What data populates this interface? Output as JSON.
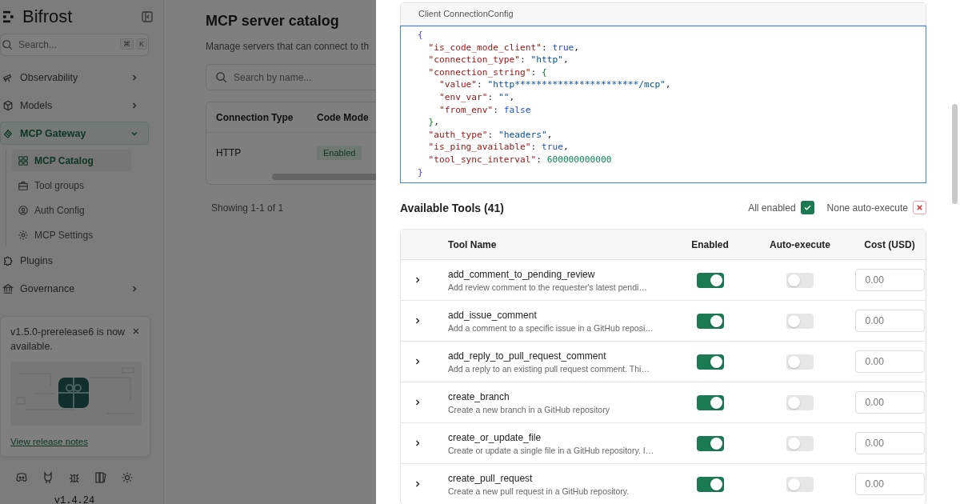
{
  "sidebar": {
    "brand": "Bifrost",
    "search": {
      "placeholder": "Search...",
      "shortcut": [
        "⌘",
        "K"
      ]
    },
    "items": [
      {
        "label": "Observability",
        "kind": "group",
        "expanded": false,
        "selected": false
      },
      {
        "label": "Models",
        "kind": "group",
        "expanded": false,
        "selected": false
      },
      {
        "label": "MCP Gateway",
        "kind": "group",
        "expanded": true,
        "selected": true,
        "children": [
          {
            "label": "MCP Catalog",
            "selected": true
          },
          {
            "label": "Tool groups",
            "selected": false
          },
          {
            "label": "Auth Config",
            "selected": false
          },
          {
            "label": "MCP Settings",
            "selected": false
          }
        ]
      },
      {
        "label": "Plugins",
        "kind": "link",
        "selected": false
      },
      {
        "label": "Governance",
        "kind": "group",
        "expanded": false,
        "selected": false
      }
    ],
    "notice": {
      "text": "v1.5.0-prerelease6 is now available.",
      "link": "View release notes"
    },
    "version": "v1.4.24"
  },
  "main": {
    "title": "MCP server catalog",
    "subtitle": "Manage servers that can connect to th",
    "search": {
      "placeholder": "Search by name..."
    },
    "table": {
      "columns": [
        "Connection Type",
        "Code Mode"
      ],
      "rows": [
        {
          "connection_type": "HTTP",
          "code_mode": "Enabled"
        }
      ]
    },
    "pagination": "Showing 1-1 of 1"
  },
  "sheet": {
    "config": {
      "title": "Client ConnectionConfig",
      "lines": [
        [
          {
            "kind": "brace",
            "text": "{"
          }
        ],
        [
          {
            "kind": "key",
            "text": "  \"is_code_mode_client\""
          },
          {
            "kind": "punct",
            "text": ": "
          },
          {
            "kind": "bool",
            "text": "true"
          },
          {
            "kind": "punct",
            "text": ","
          }
        ],
        [
          {
            "kind": "key",
            "text": "  \"connection_type\""
          },
          {
            "kind": "punct",
            "text": ": "
          },
          {
            "kind": "string",
            "text": "\"http\""
          },
          {
            "kind": "punct",
            "text": ","
          }
        ],
        [
          {
            "kind": "key",
            "text": "  \"connection_string\""
          },
          {
            "kind": "punct",
            "text": ": "
          },
          {
            "kind": "brace2",
            "text": "{"
          }
        ],
        [
          {
            "kind": "key",
            "text": "    \"value\""
          },
          {
            "kind": "punct",
            "text": ": "
          },
          {
            "kind": "string",
            "text": "\"http***********************/mcp\""
          },
          {
            "kind": "punct",
            "text": ","
          }
        ],
        [
          {
            "kind": "key",
            "text": "    \"env_var\""
          },
          {
            "kind": "punct",
            "text": ": "
          },
          {
            "kind": "string",
            "text": "\"\""
          },
          {
            "kind": "punct",
            "text": ","
          }
        ],
        [
          {
            "kind": "key",
            "text": "    \"from_env\""
          },
          {
            "kind": "punct",
            "text": ": "
          },
          {
            "kind": "bool",
            "text": "false"
          }
        ],
        [
          {
            "kind": "brace2",
            "text": "  }"
          },
          {
            "kind": "punct",
            "text": ","
          }
        ],
        [
          {
            "kind": "key",
            "text": "  \"auth_type\""
          },
          {
            "kind": "punct",
            "text": ": "
          },
          {
            "kind": "string",
            "text": "\"headers\""
          },
          {
            "kind": "punct",
            "text": ","
          }
        ],
        [
          {
            "kind": "key",
            "text": "  \"is_ping_available\""
          },
          {
            "kind": "punct",
            "text": ": "
          },
          {
            "kind": "bool",
            "text": "true"
          },
          {
            "kind": "punct",
            "text": ","
          }
        ],
        [
          {
            "kind": "key",
            "text": "  \"tool_sync_interval\""
          },
          {
            "kind": "punct",
            "text": ": "
          },
          {
            "kind": "number",
            "text": "600000000000"
          }
        ],
        [
          {
            "kind": "brace",
            "text": "}"
          }
        ]
      ]
    },
    "tools": {
      "title": "Available Tools (41)",
      "all_enabled": {
        "label": "All enabled",
        "kind": "all",
        "checked": true
      },
      "auto_execute": {
        "label": "None auto-execute",
        "kind": "none",
        "checked": true
      },
      "columns": [
        "Tool Name",
        "Enabled",
        "Auto-execute",
        "Cost (USD)"
      ],
      "rows": [
        {
          "name": "add_comment_to_pending_review",
          "description": "Add review comment to the requester's latest pendi…",
          "enabled": true,
          "auto_execute": false,
          "cost_placeholder": "0.00"
        },
        {
          "name": "add_issue_comment",
          "description": "Add a comment to a specific issue in a GitHub reposi…",
          "enabled": true,
          "auto_execute": false,
          "cost_placeholder": "0.00"
        },
        {
          "name": "add_reply_to_pull_request_comment",
          "description": "Add a reply to an existing pull request comment. Thi…",
          "enabled": true,
          "auto_execute": false,
          "cost_placeholder": "0.00"
        },
        {
          "name": "create_branch",
          "description": "Create a new branch in a GitHub repository",
          "enabled": true,
          "auto_execute": false,
          "cost_placeholder": "0.00"
        },
        {
          "name": "create_or_update_file",
          "description": "Create or update a single file in a GitHub repository. I…",
          "enabled": true,
          "auto_execute": false,
          "cost_placeholder": "0.00"
        },
        {
          "name": "create_pull_request",
          "description": "Create a new pull request in a GitHub repository.",
          "enabled": true,
          "auto_execute": false,
          "cost_placeholder": "0.00"
        }
      ]
    }
  }
}
